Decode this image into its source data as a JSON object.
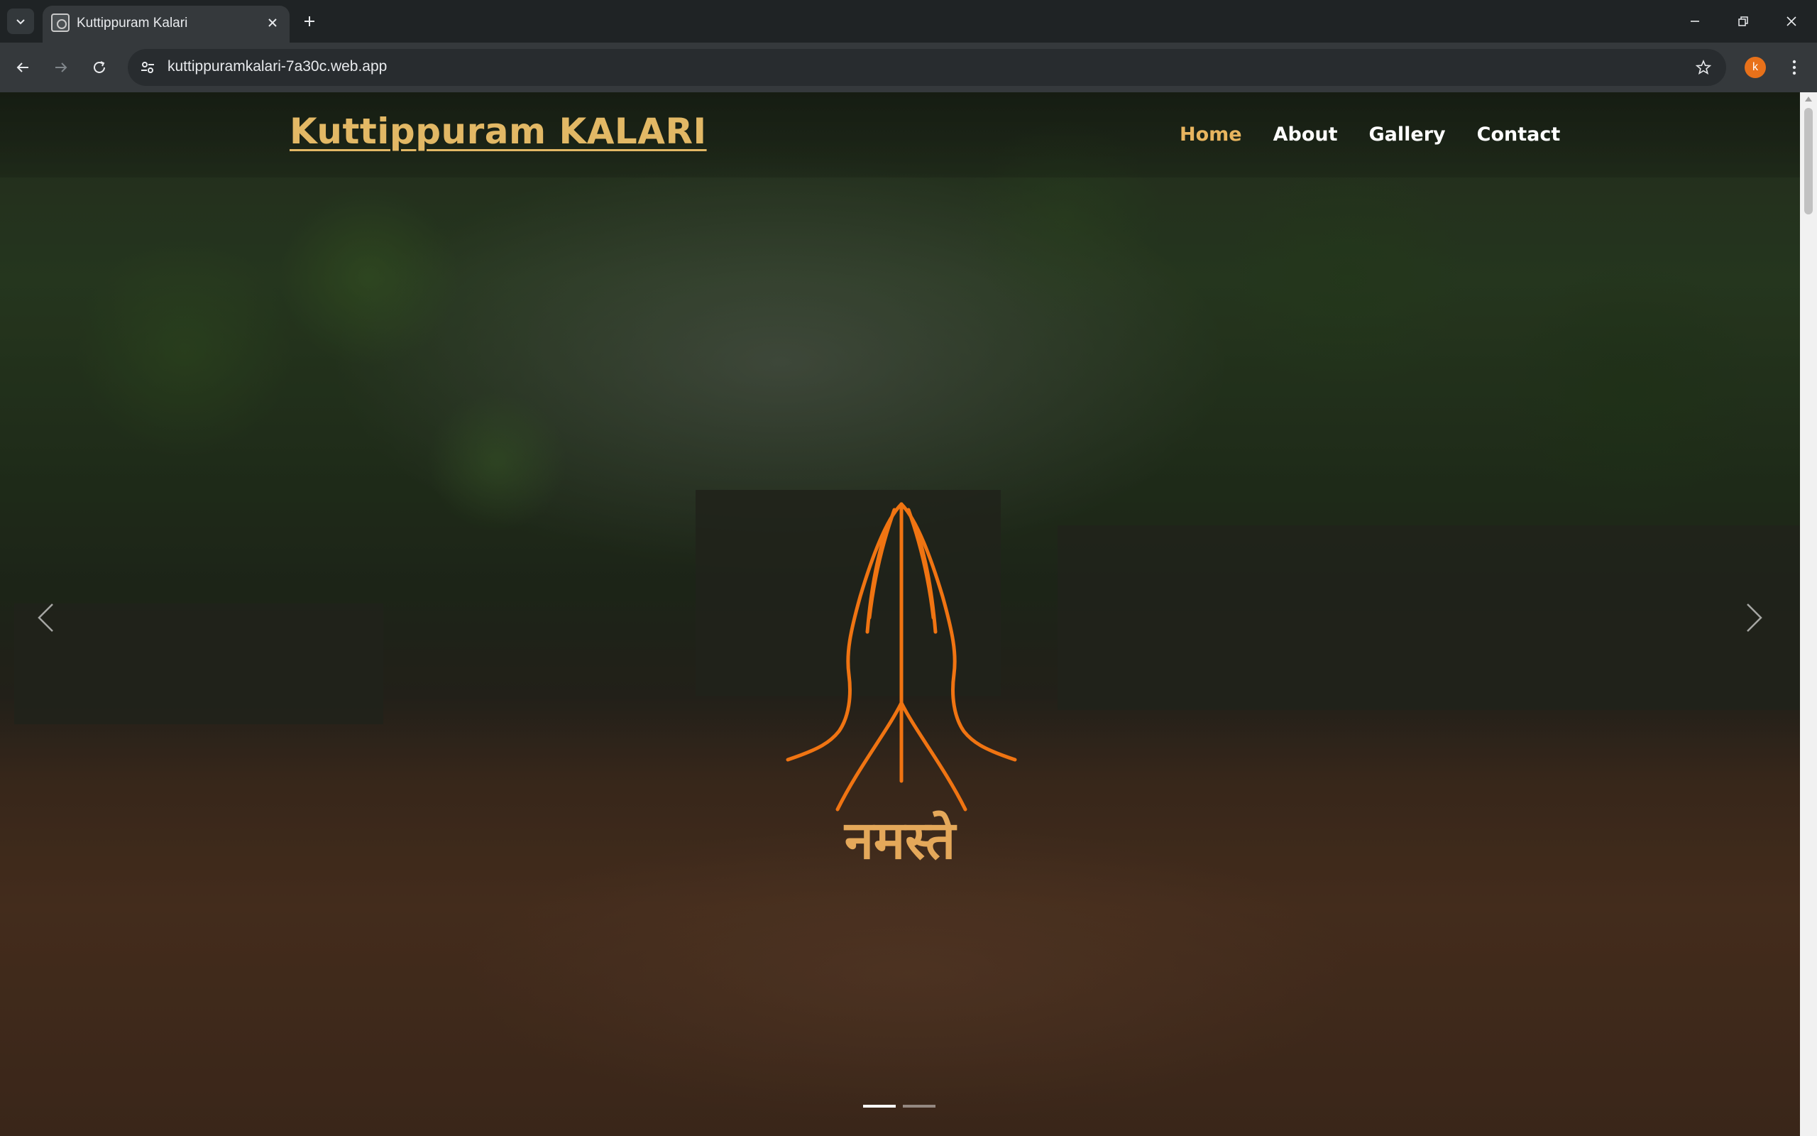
{
  "browser": {
    "tab_title": "Kuttippuram Kalari",
    "url": "kuttippuramkalari-7a30c.web.app",
    "profile_initial": "k"
  },
  "site": {
    "logo": "Kuttippuram KALARI",
    "nav": [
      {
        "label": "Home",
        "active": true
      },
      {
        "label": "About",
        "active": false
      },
      {
        "label": "Gallery",
        "active": false
      },
      {
        "label": "Contact",
        "active": false
      }
    ]
  },
  "hero": {
    "greeting": "नमस्ते",
    "icon": "namaste-hands-icon",
    "slide_count": 2,
    "active_slide": 1
  },
  "colors": {
    "accent_gold": "#e2b865",
    "hands_orange": "#f07412",
    "nav_active": "#e8b55f"
  }
}
